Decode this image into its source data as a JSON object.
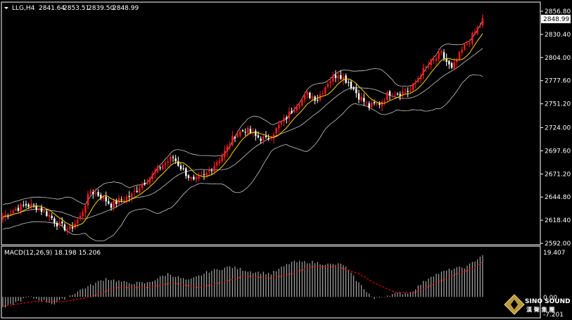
{
  "colors": {
    "background": "#000000",
    "frame": "#ffffff",
    "bull_candle": "#ff1a1a",
    "bear_candle": "#ffffff",
    "band": "#c8c8c8",
    "ma": "#ffd700",
    "macd_hist": "#c8c8c8",
    "macd_signal": "#ff0000",
    "axis_text": "#ffffff"
  },
  "header": {
    "symbol": "LLG,H4",
    "open": "2841.64",
    "high": "2853.51",
    "low": "2839.50",
    "close": "2848.99"
  },
  "price_axis": {
    "ticks": [
      "2856.80",
      "2830.40",
      "2804.00",
      "2777.60",
      "2751.20",
      "2724.00",
      "2697.60",
      "2671.20",
      "2644.80",
      "2618.40",
      "2592.00"
    ],
    "current": "2848.99"
  },
  "macd_panel": {
    "label": "MACD(12,26,9) 18.198 15.206",
    "ticks": [
      "19.407",
      "0.00",
      "-7.201"
    ]
  },
  "logo": {
    "line1": "SINO SOUND",
    "line2": "漢 聲 集 團"
  },
  "chart_data": {
    "type": "candlestick",
    "main_ylim": [
      2592.0,
      2856.8
    ],
    "macd_ylim": [
      -7.201,
      19.407
    ],
    "grid": false,
    "series": [
      {
        "name": "LLG,H4",
        "kind": "ohlc"
      },
      {
        "name": "",
        "kind": "bollinger"
      },
      {
        "name": "",
        "kind": "ma"
      },
      {
        "name": "MACD(12,26,9)",
        "kind": "macd"
      }
    ],
    "close_anchors": [
      [
        0,
        2622
      ],
      [
        4,
        2630
      ],
      [
        9,
        2636
      ],
      [
        13,
        2634
      ],
      [
        18,
        2624
      ],
      [
        22,
        2612
      ],
      [
        26,
        2608
      ],
      [
        30,
        2622
      ],
      [
        34,
        2652
      ],
      [
        38,
        2646
      ],
      [
        42,
        2636
      ],
      [
        46,
        2642
      ],
      [
        50,
        2647
      ],
      [
        54,
        2660
      ],
      [
        58,
        2670
      ],
      [
        62,
        2682
      ],
      [
        66,
        2690
      ],
      [
        70,
        2675
      ],
      [
        74,
        2662
      ],
      [
        78,
        2668
      ],
      [
        82,
        2682
      ],
      [
        86,
        2696
      ],
      [
        90,
        2716
      ],
      [
        94,
        2722
      ],
      [
        98,
        2714
      ],
      [
        102,
        2710
      ],
      [
        106,
        2722
      ],
      [
        110,
        2736
      ],
      [
        114,
        2751
      ],
      [
        118,
        2762
      ],
      [
        122,
        2757
      ],
      [
        126,
        2776
      ],
      [
        130,
        2786
      ],
      [
        134,
        2776
      ],
      [
        138,
        2760
      ],
      [
        142,
        2748
      ],
      [
        146,
        2752
      ],
      [
        150,
        2764
      ],
      [
        154,
        2764
      ],
      [
        158,
        2766
      ],
      [
        162,
        2786
      ],
      [
        166,
        2798
      ],
      [
        170,
        2808
      ],
      [
        174,
        2790
      ],
      [
        178,
        2812
      ],
      [
        182,
        2828
      ],
      [
        186,
        2846
      ]
    ],
    "macd_anchors": [
      [
        0,
        -5
      ],
      [
        10,
        0
      ],
      [
        20,
        -3
      ],
      [
        30,
        3
      ],
      [
        40,
        8
      ],
      [
        48,
        6
      ],
      [
        56,
        6
      ],
      [
        64,
        10
      ],
      [
        72,
        7
      ],
      [
        80,
        11
      ],
      [
        88,
        13
      ],
      [
        96,
        11
      ],
      [
        104,
        10
      ],
      [
        112,
        15
      ],
      [
        120,
        15
      ],
      [
        126,
        14
      ],
      [
        132,
        14
      ],
      [
        138,
        6
      ],
      [
        144,
        -1
      ],
      [
        150,
        1
      ],
      [
        158,
        2
      ],
      [
        166,
        9
      ],
      [
        174,
        12
      ],
      [
        180,
        13
      ],
      [
        186,
        18.2
      ]
    ],
    "signal_anchors": [
      [
        0,
        -4
      ],
      [
        12,
        -2
      ],
      [
        24,
        -2
      ],
      [
        34,
        0
      ],
      [
        44,
        4
      ],
      [
        56,
        4
      ],
      [
        66,
        6
      ],
      [
        76,
        4
      ],
      [
        84,
        6
      ],
      [
        94,
        9
      ],
      [
        104,
        8
      ],
      [
        112,
        10
      ],
      [
        120,
        13
      ],
      [
        130,
        13
      ],
      [
        138,
        10
      ],
      [
        144,
        6
      ],
      [
        152,
        2
      ],
      [
        160,
        2
      ],
      [
        168,
        6
      ],
      [
        176,
        10
      ],
      [
        182,
        12
      ],
      [
        186,
        15.2
      ]
    ]
  }
}
